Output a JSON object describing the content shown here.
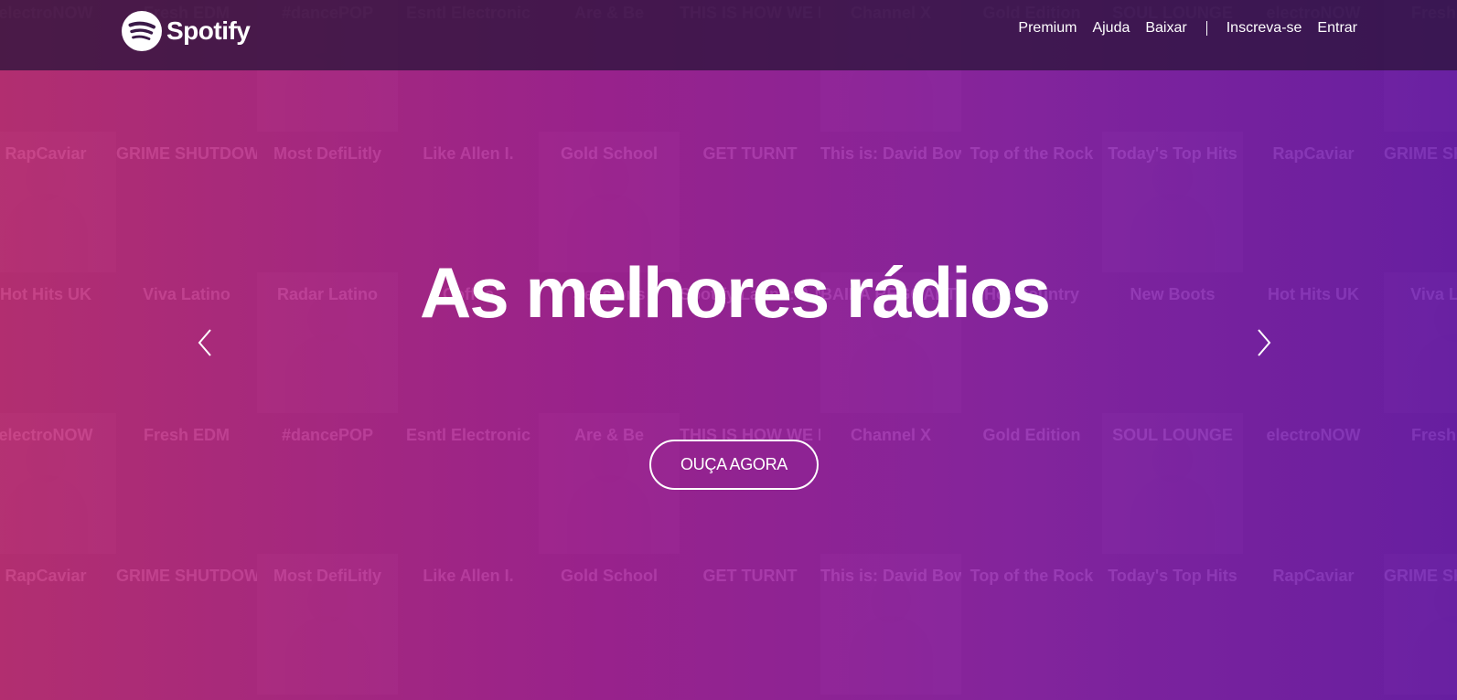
{
  "header": {
    "logo_text": "Spotify",
    "nav": {
      "premium": "Premium",
      "ajuda": "Ajuda",
      "baixar": "Baixar",
      "inscreva": "Inscreva-se",
      "entrar": "Entrar"
    }
  },
  "hero": {
    "title": "As melhores rádios",
    "cta_label": "OUÇA AGORA"
  },
  "colors": {
    "gradient_left": "#de3a8c",
    "gradient_right": "#8026c8",
    "header_bg": "#2d143c",
    "text": "#ffffff"
  },
  "background_tiles": [
    "electroNOW",
    "Fresh EDM",
    "#dancePOP",
    "Esntl Electronic",
    "Are & Be",
    "THIS IS HOW WE DO",
    "Channel X",
    "Gold Edition",
    "SOUL LOUNGE",
    "electroNOW",
    "Fresh EDM",
    "RapCaviar",
    "GRIME SHUTDOWN",
    "Most DefiLitly",
    "Like Allen I.",
    "Gold School",
    "GET TURNT",
    "This is: David Bowie",
    "Top of the Rock",
    "Today's Top Hits",
    "RapCaviar",
    "GRIME SHUTDOWN",
    "Hot Hits UK",
    "Viva Latino",
    "Radar Latino",
    "Coffee",
    "Sessions",
    "Spotify Latino: A New America",
    "BAILA REGGAETON",
    "Hot Country",
    "New Boots",
    "Hot Hits UK",
    "Viva Latino",
    "electroNOW",
    "Fresh EDM",
    "#dancePOP",
    "Esntl Electronic",
    "Are & Be",
    "THIS IS HOW WE DO",
    "Channel X",
    "Gold Edition",
    "SOUL LOUNGE",
    "electroNOW",
    "Fresh EDM",
    "RapCaviar",
    "GRIME SHUTDOWN",
    "Most DefiLitly",
    "Like Allen I.",
    "Gold School",
    "GET TURNT",
    "This is: David Bowie",
    "Top of the Rock",
    "Today's Top Hits",
    "RapCaviar",
    "GRIME SHUTDOWN"
  ],
  "icons": {
    "logo": "spotify-logo-icon",
    "prev": "chevron-left-icon",
    "next": "chevron-right-icon"
  }
}
